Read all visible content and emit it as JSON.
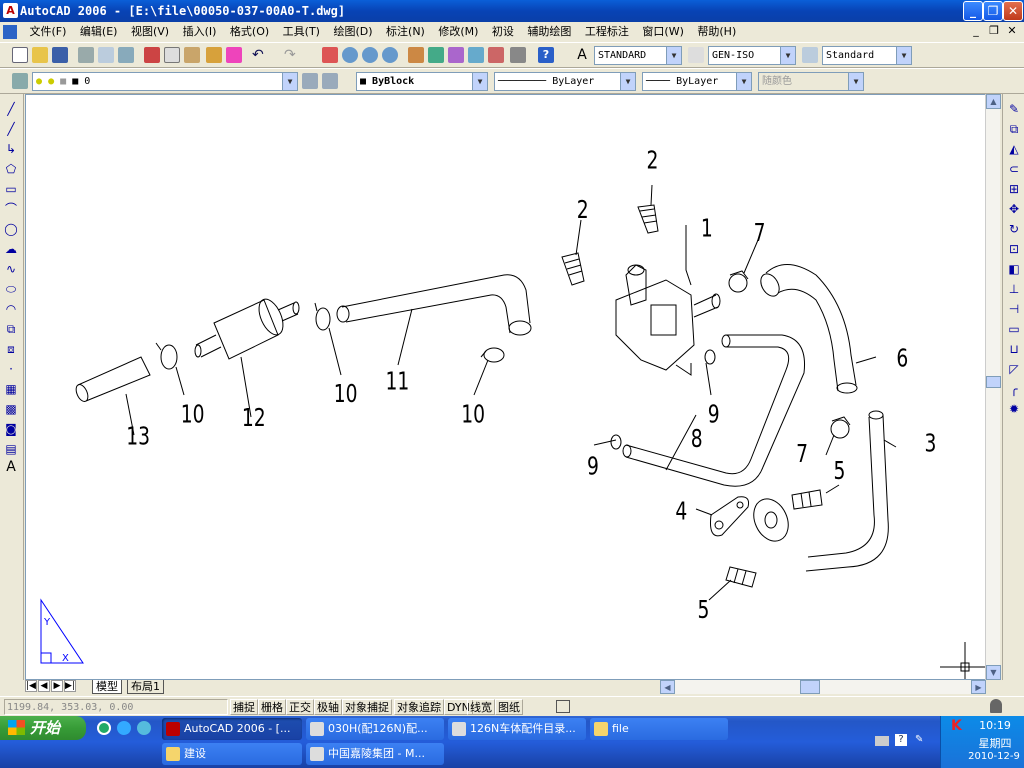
{
  "window": {
    "title": "AutoCAD 2006 - [E:\\file\\00050-037-00A0-T.dwg]"
  },
  "menu": [
    "文件(F)",
    "编辑(E)",
    "视图(V)",
    "插入(I)",
    "格式(O)",
    "工具(T)",
    "绘图(D)",
    "标注(N)",
    "修改(M)",
    "初设",
    "辅助绘图",
    "工程标注",
    "窗口(W)",
    "帮助(H)"
  ],
  "styles": {
    "text_style": "STANDARD",
    "dim_style": "GEN-ISO",
    "table_style": "Standard"
  },
  "properties": {
    "layer": "0",
    "color": "ByBlock",
    "linetype": "ByLayer",
    "lineweight": "ByLayer",
    "plotstyle": "随颜色"
  },
  "drawing": {
    "labels": [
      "1",
      "2",
      "2",
      "3",
      "4",
      "5",
      "5",
      "6",
      "7",
      "7",
      "8",
      "9",
      "9",
      "10",
      "10",
      "10",
      "11",
      "12",
      "13"
    ],
    "ucs": {
      "x": "X",
      "y": "Y"
    }
  },
  "tabs": {
    "model": "模型",
    "layout": "布局1"
  },
  "status": {
    "coords": "1199.84, 353.03, 0.00",
    "buttons": [
      "捕捉",
      "栅格",
      "正交",
      "极轴",
      "对象捕捉",
      "对象追踪",
      "DYN",
      "线宽",
      "图纸"
    ]
  },
  "taskbar": {
    "start": "开始",
    "row1": [
      "AutoCAD 2006 - [...",
      "030H(配126N)配...",
      "126N车体配件目录...",
      "file"
    ],
    "row2": [
      "建设",
      "中国嘉陵集团 - M..."
    ],
    "time": "10:19",
    "weekday": "星期四",
    "date": "2010-12-9"
  },
  "colors": {
    "title_blue": "#0A5FD8",
    "face": "#ECE9D8",
    "taskbar_blue": "#245DDA",
    "start_green": "#379C37"
  }
}
